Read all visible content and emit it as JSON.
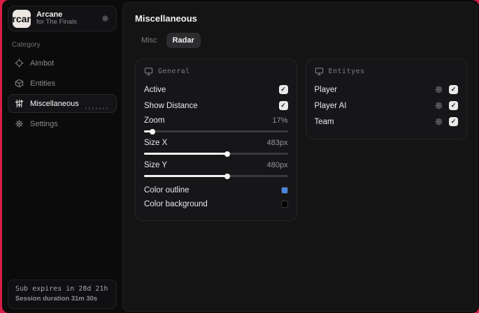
{
  "window": {
    "app_title": "Arcane",
    "app_subtitle": "for The Finals"
  },
  "sidebar": {
    "category_label": "Category",
    "items": [
      {
        "label": "Aimbot",
        "icon": "crosshair-icon",
        "active": false
      },
      {
        "label": "Entities",
        "icon": "box-icon",
        "active": false
      },
      {
        "label": "Miscellaneous",
        "icon": "sliders-icon",
        "active": true
      },
      {
        "label": "Settings",
        "icon": "gear-icon",
        "active": false
      }
    ],
    "status": {
      "sub_expires": "Sub expires in 28d 21h",
      "session_duration": "Session duration 31m 30s"
    }
  },
  "main": {
    "title": "Miscellaneous",
    "tabs": [
      {
        "label": "Misc",
        "active": false
      },
      {
        "label": "Radar",
        "active": true
      }
    ],
    "general_panel": {
      "title": "General",
      "toggles": [
        {
          "label": "Active",
          "checked": true
        },
        {
          "label": "Show Distance",
          "checked": true
        }
      ],
      "sliders": [
        {
          "label": "Zoom",
          "value": "17%",
          "fill_pct": 6
        },
        {
          "label": "Size X",
          "value": "483px",
          "fill_pct": 58
        },
        {
          "label": "Size Y",
          "value": "480px",
          "fill_pct": 58
        }
      ],
      "colors": [
        {
          "label": "Color outline",
          "swatch": "#4a86e0"
        },
        {
          "label": "Color background",
          "swatch": "#000000"
        }
      ]
    },
    "entities_panel": {
      "title": "Entityes",
      "rows": [
        {
          "label": "Player",
          "checked": true
        },
        {
          "label": "Player AI",
          "checked": true
        },
        {
          "label": "Team",
          "checked": true
        }
      ]
    }
  },
  "icons": {
    "check": "✓"
  },
  "colors": {
    "accent_blue": "#4a86e0",
    "desktop_red": "#d81e47"
  }
}
